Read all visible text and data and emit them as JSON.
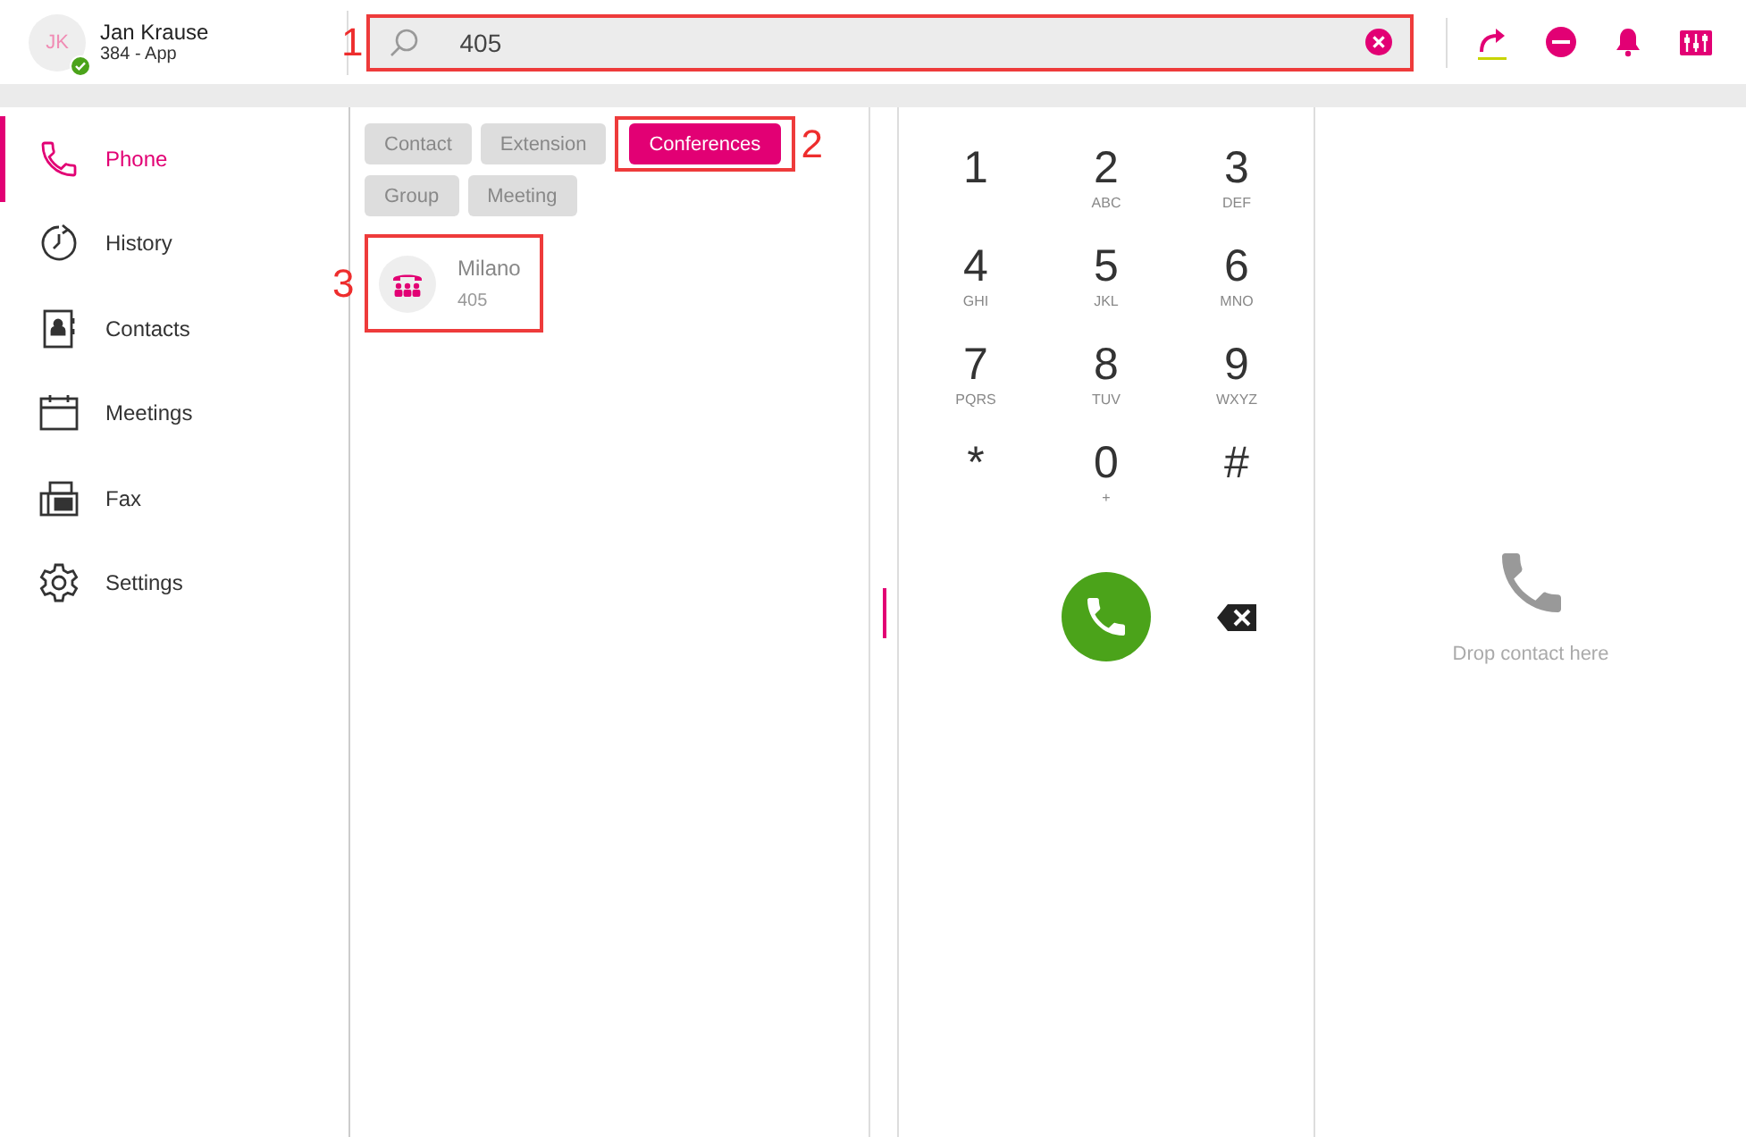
{
  "user": {
    "initials": "JK",
    "name": "Jan Krause",
    "line": "384 - App",
    "online": true
  },
  "search": {
    "value": "405",
    "annotation": "1"
  },
  "toolbar": [
    {
      "kind": "forward"
    },
    {
      "kind": "dnd"
    },
    {
      "kind": "bell"
    },
    {
      "kind": "mixer"
    }
  ],
  "sidebar": {
    "items": [
      {
        "label": "Phone",
        "kind": "phone",
        "selected": true
      },
      {
        "label": "History",
        "kind": "history",
        "selected": false
      },
      {
        "label": "Contacts",
        "kind": "contacts",
        "selected": false
      },
      {
        "label": "Meetings",
        "kind": "meetings",
        "selected": false
      },
      {
        "label": "Fax",
        "kind": "fax",
        "selected": false
      },
      {
        "label": "Settings",
        "kind": "settings",
        "selected": false
      }
    ]
  },
  "filters": [
    {
      "label": "Contact",
      "selected": false
    },
    {
      "label": "Extension",
      "selected": false
    },
    {
      "label": "Conferences",
      "selected": true,
      "annotation": "2"
    },
    {
      "label": "Group",
      "selected": false
    },
    {
      "label": "Meeting",
      "selected": false
    }
  ],
  "results": [
    {
      "name": "Milano",
      "number": "405",
      "annotation": "3"
    }
  ],
  "dialpad": [
    {
      "digit": "1"
    },
    {
      "digit": "2",
      "letters": "ABC"
    },
    {
      "digit": "3",
      "letters": "DEF"
    },
    {
      "digit": "4",
      "letters": "GHI"
    },
    {
      "digit": "5",
      "letters": "JKL"
    },
    {
      "digit": "6",
      "letters": "MNO"
    },
    {
      "digit": "7",
      "letters": "PQRS"
    },
    {
      "digit": "8",
      "letters": "TUV"
    },
    {
      "digit": "9",
      "letters": "WXYZ"
    },
    {
      "digit": "*"
    },
    {
      "digit": "0",
      "letters": "+"
    },
    {
      "digit": "#"
    }
  ],
  "dropzone": {
    "hint": "Drop contact here"
  }
}
